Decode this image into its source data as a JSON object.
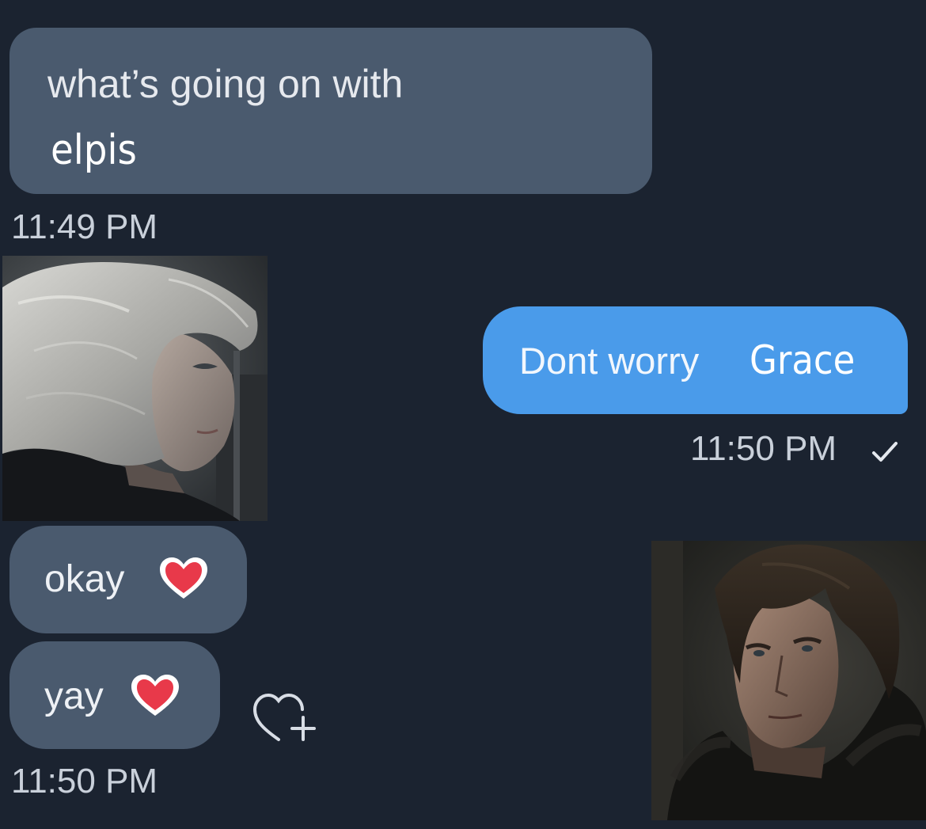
{
  "conversation": {
    "messages": [
      {
        "sender": "them",
        "lines": [
          "what’s going on with",
          "elpis"
        ],
        "time": "11:49 PM"
      },
      {
        "sender": "them",
        "type": "image",
        "depicts": "woman-portrait"
      },
      {
        "sender": "me",
        "text_a": "Dont worry",
        "text_b": "Grace",
        "time": "11:50 PM",
        "status_icon": "checkmark-icon"
      },
      {
        "sender": "them",
        "text": "okay",
        "reaction_icon": "heart-icon"
      },
      {
        "sender": "them",
        "text": "yay",
        "reaction_icon": "heart-icon",
        "time": "11:50 PM"
      },
      {
        "sender": "me",
        "type": "image",
        "depicts": "man-portrait"
      }
    ],
    "add_reaction_icon": "add-reaction-heart-icon"
  },
  "colors": {
    "background": "#1b2330",
    "incoming_bubble": "#4a5a6e",
    "outgoing_bubble": "#4a9bea",
    "heart": "#e8394a"
  }
}
